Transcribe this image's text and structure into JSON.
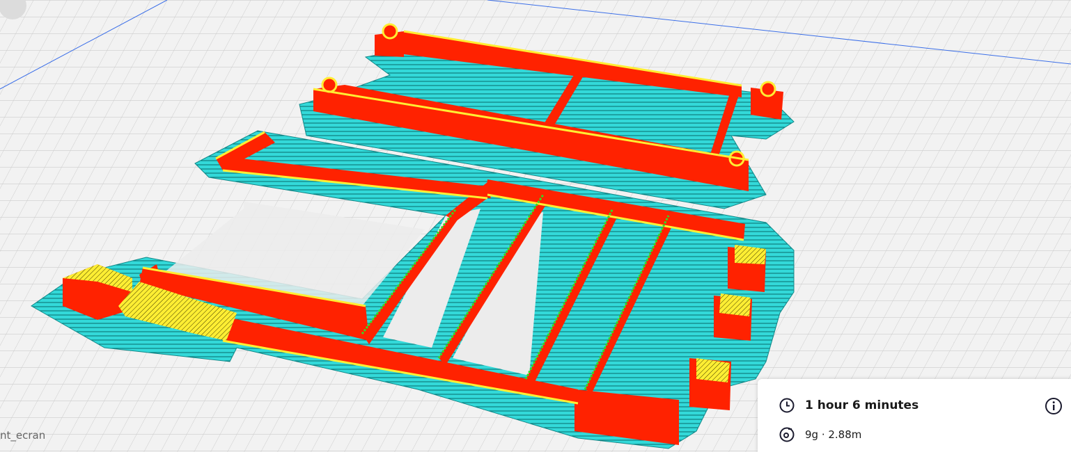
{
  "viewport": {
    "object_filename_partial": "nt_ecran"
  },
  "print_estimate": {
    "time": "1 hour 6 minutes",
    "material": "9g · 2.88m"
  },
  "colors": {
    "wall_red": "#ff2200",
    "skin_yellow": "#ffee33",
    "infill_green": "#33dd22",
    "skirt_cyan": "#33dddd",
    "plate_bg": "#f2f2f2",
    "grid_line": "#c8c8c8"
  },
  "icons": {
    "time": "clock-icon",
    "material": "spool-icon",
    "info": "info-icon"
  }
}
